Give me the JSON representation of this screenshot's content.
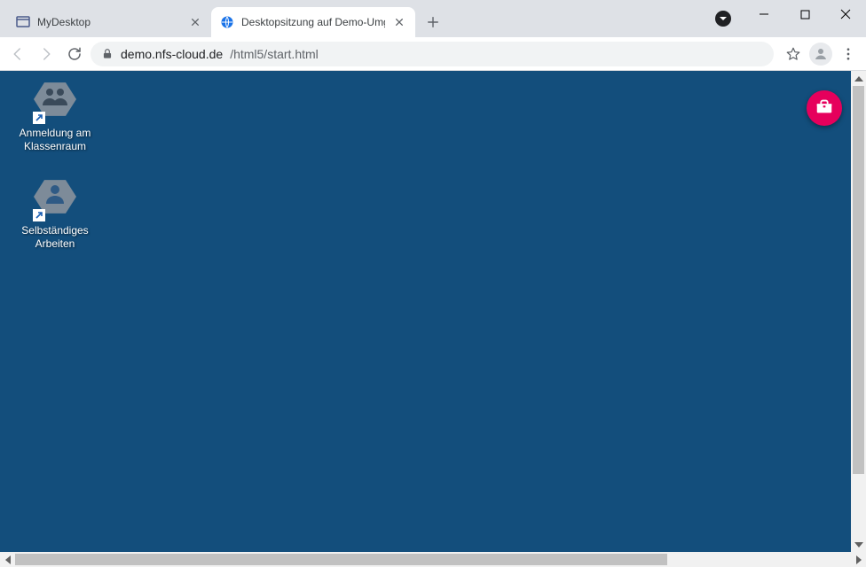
{
  "browser": {
    "tabs": [
      {
        "title": "MyDesktop",
        "active": false
      },
      {
        "title": "Desktopsitzung auf Demo-Umge",
        "active": true
      }
    ],
    "url_host": "demo.nfs-cloud.de",
    "url_path": "/html5/start.html"
  },
  "desktop": {
    "icons": [
      {
        "label": "Anmeldung am Klassenraum",
        "kind": "classroom"
      },
      {
        "label": "Selbständiges Arbeiten",
        "kind": "single-user"
      }
    ],
    "fab": "toolbox"
  }
}
